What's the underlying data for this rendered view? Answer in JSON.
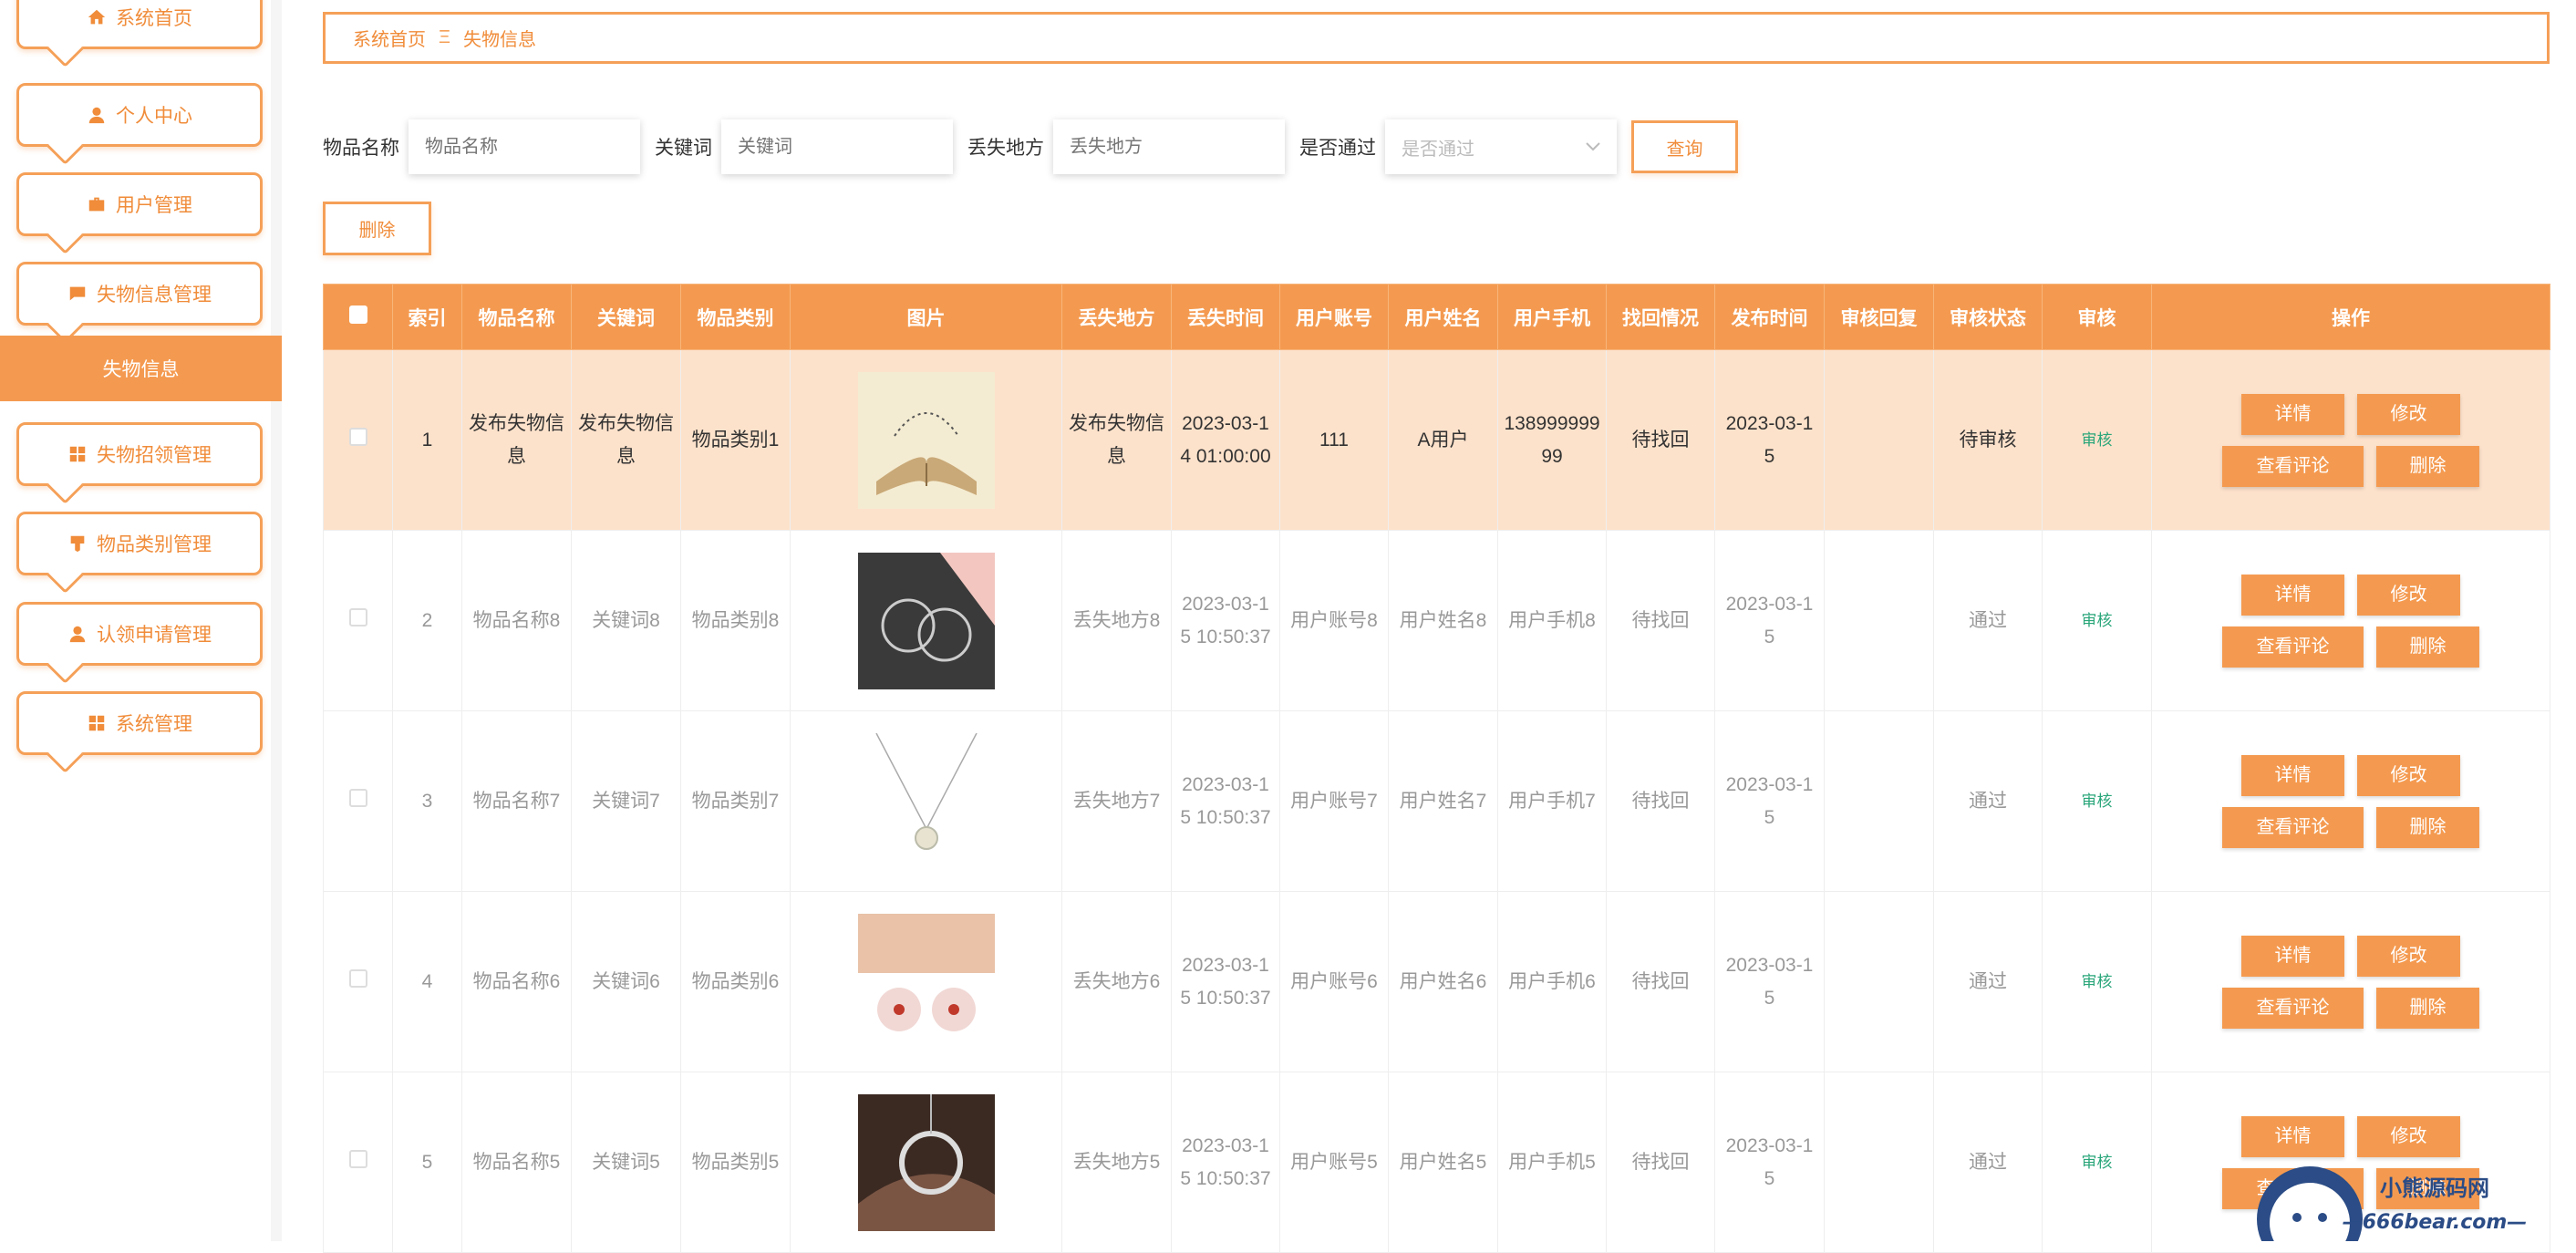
{
  "sidebar": {
    "items": [
      {
        "label": "系统首页",
        "icon": "home-icon"
      },
      {
        "label": "个人中心",
        "icon": "user-icon"
      },
      {
        "label": "用户管理",
        "icon": "briefcase-icon"
      },
      {
        "label": "失物信息管理",
        "icon": "chat-icon"
      },
      {
        "label": "失物招领管理",
        "icon": "grid-icon"
      },
      {
        "label": "物品类别管理",
        "icon": "tag-icon"
      },
      {
        "label": "认领申请管理",
        "icon": "user-icon"
      },
      {
        "label": "系统管理",
        "icon": "grid-icon"
      }
    ],
    "active_sub": "失物信息"
  },
  "breadcrumb": {
    "home": "系统首页",
    "sep": "Ξ",
    "current": "失物信息"
  },
  "search": {
    "name_label": "物品名称",
    "name_placeholder": "物品名称",
    "keyword_label": "关键词",
    "keyword_placeholder": "关键词",
    "place_label": "丢失地方",
    "place_placeholder": "丢失地方",
    "pass_label": "是否通过",
    "pass_placeholder": "是否通过",
    "query_button": "查询",
    "delete_button": "删除"
  },
  "table": {
    "headers": [
      "索引",
      "物品名称",
      "关键词",
      "物品类别",
      "图片",
      "丢失地方",
      "丢失时间",
      "用户账号",
      "用户姓名",
      "用户手机",
      "找回情况",
      "发布时间",
      "审核回复",
      "审核状态",
      "审核",
      "操作"
    ],
    "rows": [
      {
        "idx": "1",
        "name": "发布失物信息",
        "kw": "发布失物信息",
        "cat": "物品类别1",
        "pic": "book",
        "place": "发布失物信息",
        "time": "2023-03-14 01:00:00",
        "acct": "111",
        "uname": "A用户",
        "phone": "13899999999",
        "found": "待找回",
        "pub": "2023-03-15",
        "reply": "",
        "status": "待审核",
        "audit": "审核"
      },
      {
        "idx": "2",
        "name": "物品名称8",
        "kw": "关键词8",
        "cat": "物品类别8",
        "pic": "earrings",
        "place": "丢失地方8",
        "time": "2023-03-15 10:50:37",
        "acct": "用户账号8",
        "uname": "用户姓名8",
        "phone": "用户手机8",
        "found": "待找回",
        "pub": "2023-03-15",
        "reply": "",
        "status": "通过",
        "audit": "审核"
      },
      {
        "idx": "3",
        "name": "物品名称7",
        "kw": "关键词7",
        "cat": "物品类别7",
        "pic": "necklace",
        "place": "丢失地方7",
        "time": "2023-03-15 10:50:37",
        "acct": "用户账号7",
        "uname": "用户姓名7",
        "phone": "用户手机7",
        "found": "待找回",
        "pub": "2023-03-15",
        "reply": "",
        "status": "通过",
        "audit": "审核"
      },
      {
        "idx": "4",
        "name": "物品名称6",
        "kw": "关键词6",
        "cat": "物品类别6",
        "pic": "studs",
        "place": "丢失地方6",
        "time": "2023-03-15 10:50:37",
        "acct": "用户账号6",
        "uname": "用户姓名6",
        "phone": "用户手机6",
        "found": "待找回",
        "pub": "2023-03-15",
        "reply": "",
        "status": "通过",
        "audit": "审核"
      },
      {
        "idx": "5",
        "name": "物品名称5",
        "kw": "关键词5",
        "cat": "物品类别5",
        "pic": "ring",
        "place": "丢失地方5",
        "time": "2023-03-15 10:50:37",
        "acct": "用户账号5",
        "uname": "用户姓名5",
        "phone": "用户手机5",
        "found": "待找回",
        "pub": "2023-03-15",
        "reply": "",
        "status": "通过",
        "audit": "审核"
      }
    ],
    "ops": {
      "detail": "详情",
      "edit": "修改",
      "comments": "查看评论",
      "delete": "删除"
    }
  },
  "watermark": {
    "title": "小熊源码网",
    "url": "—666bear.com—"
  },
  "colors": {
    "accent": "#f49a50",
    "border": "#f5a058",
    "highlight_row": "#fde2cb",
    "audit": "#2aa67a"
  }
}
